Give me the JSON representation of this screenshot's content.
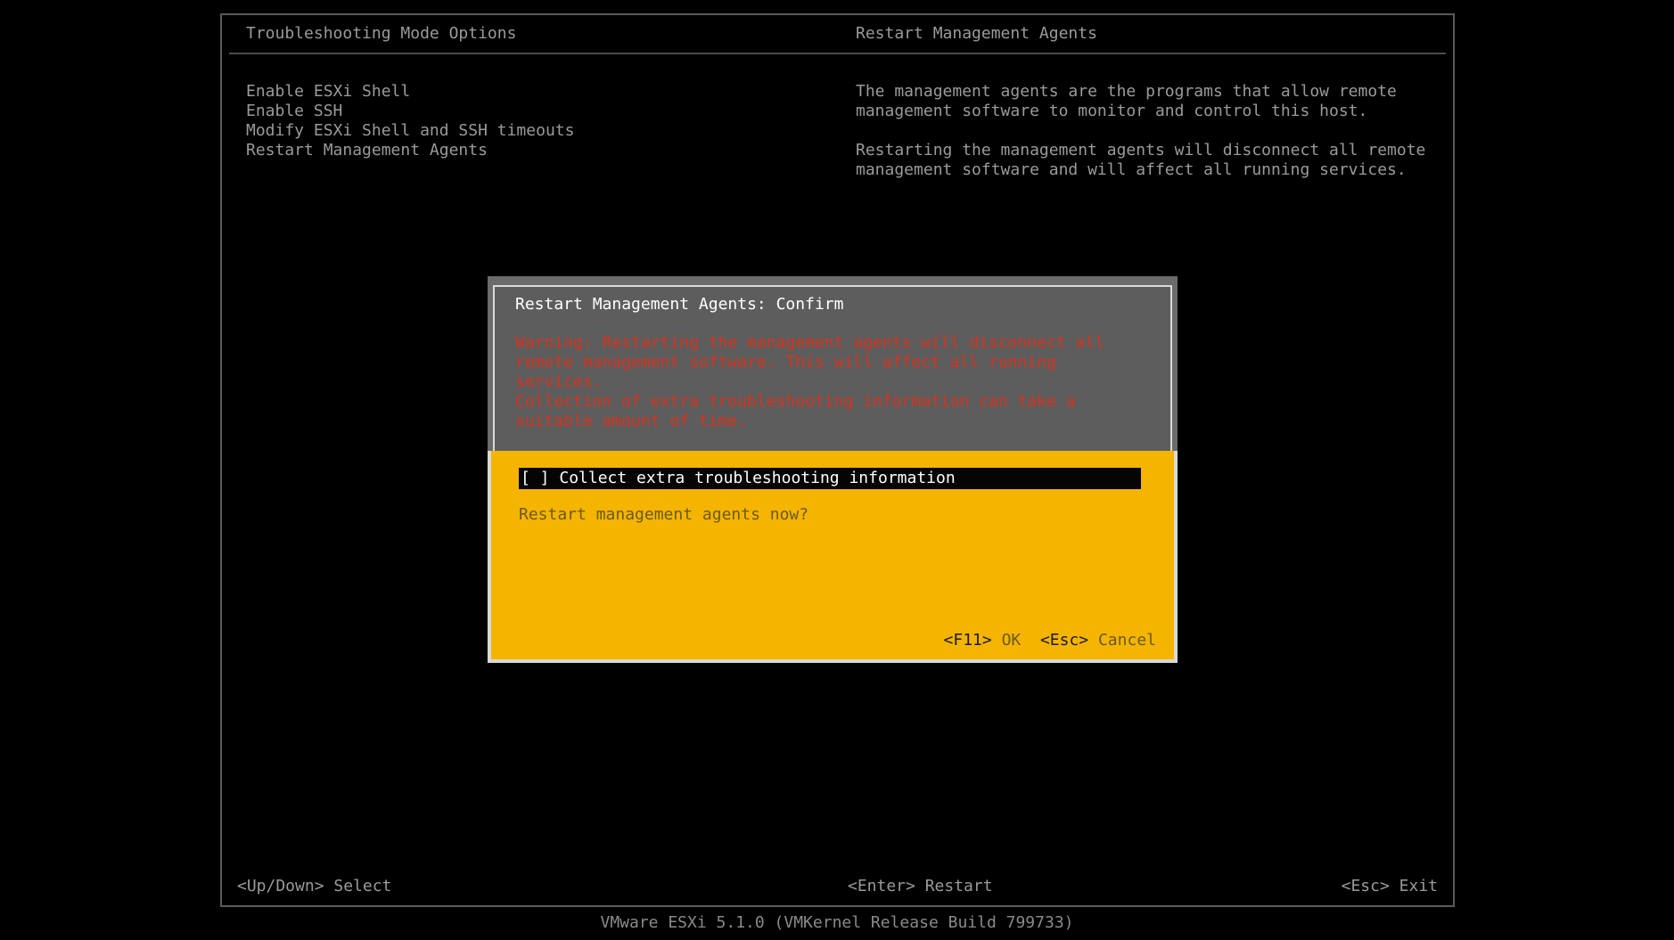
{
  "header": {
    "left_title": "Troubleshooting Mode Options",
    "right_title": "Restart Management Agents"
  },
  "menu": {
    "items": [
      "Enable ESXi Shell",
      "Enable SSH",
      "Modify ESXi Shell and SSH timeouts",
      "Restart Management Agents"
    ]
  },
  "description": {
    "para1": "The management agents are the programs that allow remote\nmanagement software to monitor and control this host.",
    "para2": "Restarting the management agents will disconnect all remote\nmanagement software and will affect all running services."
  },
  "dialog": {
    "title": "Restart Management Agents: Confirm",
    "warning": "Warning: Restarting the management agents will disconnect all\nremote management software. This will affect all running\nservices.\nCollection of extra troubleshooting information can take a\nsuitable amount of time.",
    "checkbox_mark": "[ ]",
    "checkbox_label": "Collect extra troubleshooting information",
    "question": "Restart management agents now?",
    "ok_key": "<F11>",
    "ok_label": "OK",
    "cancel_key": "<Esc>",
    "cancel_label": "Cancel"
  },
  "footer": {
    "select_hint": "<Up/Down> Select",
    "restart_hint": "<Enter> Restart",
    "exit_hint": "<Esc> Exit"
  },
  "version": "VMware ESXi 5.1.0 (VMKernel Release Build 799733)",
  "colors": {
    "background": "#000000",
    "dialog_accent": "#f5b400",
    "warning_text": "#d8321c"
  }
}
